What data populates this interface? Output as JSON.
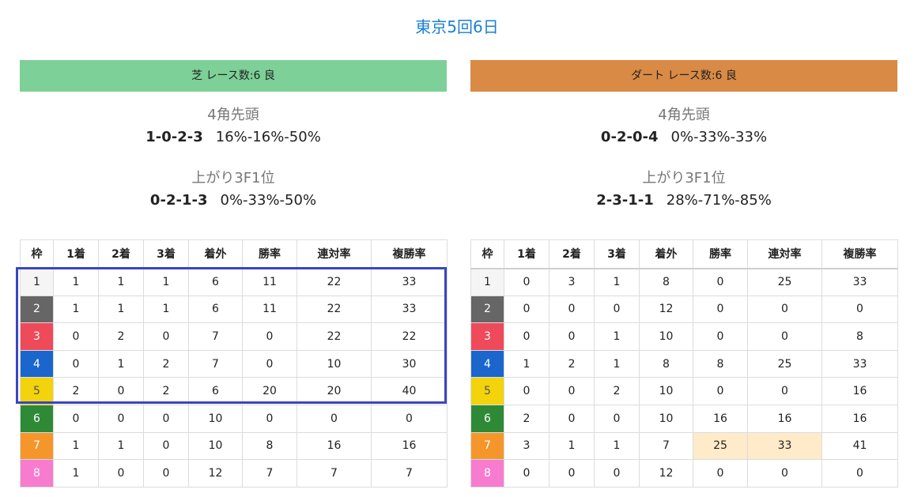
{
  "page": {
    "title": "東京5回6日"
  },
  "colors": {
    "title": "#1a7fd4",
    "turf_header": "#7dd097",
    "dirt_header": "#d98a44",
    "highlight_box": "#3a45c4",
    "highlight_cell": "#ffebc9"
  },
  "columns": [
    "枠",
    "1着",
    "2着",
    "3着",
    "着外",
    "勝率",
    "連対率",
    "複勝率"
  ],
  "turf": {
    "header": "芝 レース数:6 良",
    "corner_label": "4角先頭",
    "corner_record": [
      "1",
      "0",
      "2",
      "3"
    ],
    "corner_rates": "16%-16%-50%",
    "last3f_label": "上がり3F1位",
    "last3f_record": [
      "0",
      "2",
      "1",
      "3"
    ],
    "last3f_rates": "0%-33%-50%",
    "rows": [
      [
        "1",
        "1",
        "1",
        "1",
        "6",
        "11",
        "22",
        "33"
      ],
      [
        "2",
        "1",
        "1",
        "1",
        "6",
        "11",
        "22",
        "33"
      ],
      [
        "3",
        "0",
        "2",
        "0",
        "7",
        "0",
        "22",
        "22"
      ],
      [
        "4",
        "0",
        "1",
        "2",
        "7",
        "0",
        "10",
        "30"
      ],
      [
        "5",
        "2",
        "0",
        "2",
        "6",
        "20",
        "20",
        "40"
      ],
      [
        "6",
        "0",
        "0",
        "0",
        "10",
        "0",
        "0",
        "0"
      ],
      [
        "7",
        "1",
        "1",
        "0",
        "10",
        "8",
        "16",
        "16"
      ],
      [
        "8",
        "1",
        "0",
        "0",
        "12",
        "7",
        "7",
        "7"
      ]
    ]
  },
  "dirt": {
    "header": "ダート レース数:6 良",
    "corner_label": "4角先頭",
    "corner_record": [
      "0",
      "2",
      "0",
      "4"
    ],
    "corner_rates": "0%-33%-33%",
    "last3f_label": "上がり3F1位",
    "last3f_record": [
      "2",
      "3",
      "1",
      "1"
    ],
    "last3f_rates": "28%-71%-85%",
    "rows": [
      [
        "1",
        "0",
        "3",
        "1",
        "8",
        "0",
        "25",
        "33"
      ],
      [
        "2",
        "0",
        "0",
        "0",
        "12",
        "0",
        "0",
        "0"
      ],
      [
        "3",
        "0",
        "0",
        "1",
        "10",
        "0",
        "0",
        "8"
      ],
      [
        "4",
        "1",
        "2",
        "1",
        "8",
        "8",
        "25",
        "33"
      ],
      [
        "5",
        "0",
        "0",
        "2",
        "10",
        "0",
        "0",
        "16"
      ],
      [
        "6",
        "2",
        "0",
        "0",
        "10",
        "16",
        "16",
        "16"
      ],
      [
        "7",
        "3",
        "1",
        "1",
        "7",
        "25",
        "33",
        "41"
      ],
      [
        "8",
        "0",
        "0",
        "0",
        "12",
        "0",
        "0",
        "0"
      ]
    ]
  }
}
